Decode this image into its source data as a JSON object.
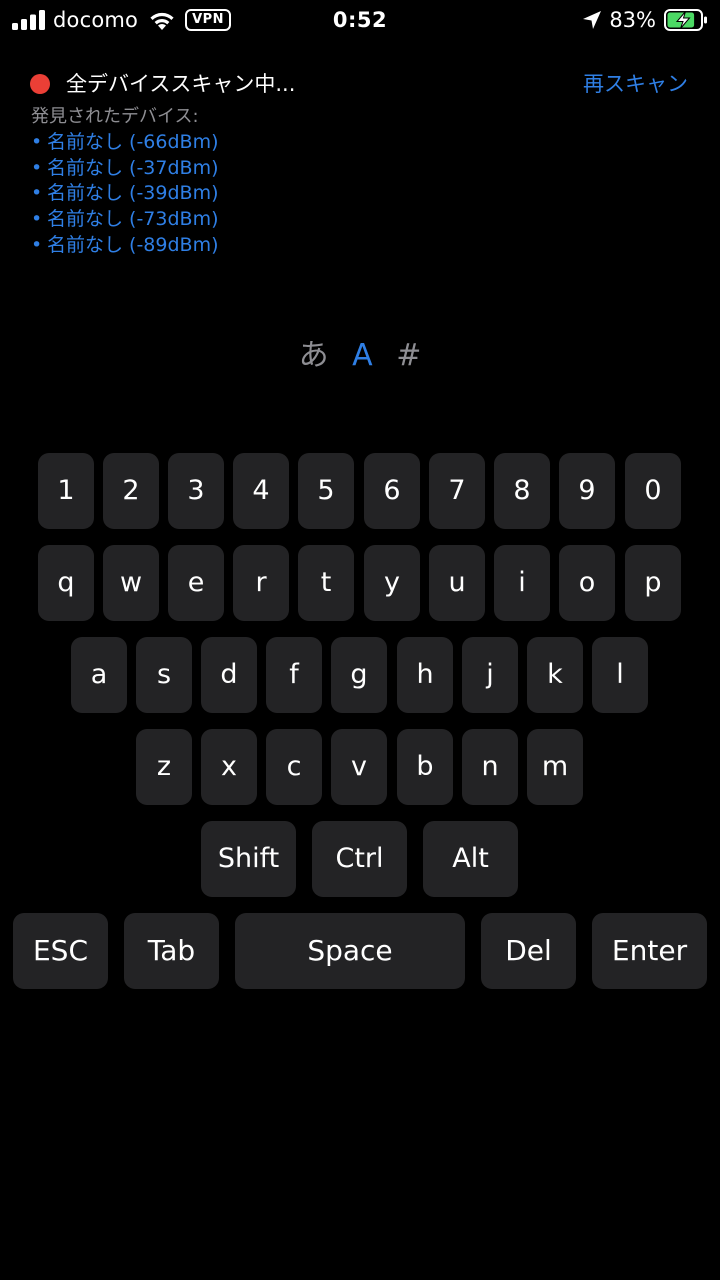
{
  "status_bar": {
    "carrier": "docomo",
    "vpn": "VPN",
    "time": "0:52",
    "battery_percent": "83%",
    "battery_level": 0.83,
    "icons": [
      "signal-icon",
      "wifi-icon",
      "location-icon",
      "battery-charging-icon"
    ]
  },
  "scan": {
    "status": "全デバイススキャン中...",
    "rescan_label": "再スキャン",
    "found_label": "発見されたデバイス:",
    "bullet": "•",
    "devices": [
      "名前なし (-66dBm)",
      "名前なし (-37dBm)",
      "名前なし (-39dBm)",
      "名前なし (-73dBm)",
      "名前なし (-89dBm)"
    ]
  },
  "modes": [
    "あ",
    "A",
    "#"
  ],
  "active_mode": "A",
  "keyboard": {
    "row_numbers": [
      "1",
      "2",
      "3",
      "4",
      "5",
      "6",
      "7",
      "8",
      "9",
      "0"
    ],
    "row_q": [
      "q",
      "w",
      "e",
      "r",
      "t",
      "y",
      "u",
      "i",
      "o",
      "p"
    ],
    "row_a": [
      "a",
      "s",
      "d",
      "f",
      "g",
      "h",
      "j",
      "k",
      "l"
    ],
    "row_z": [
      "z",
      "x",
      "c",
      "v",
      "b",
      "n",
      "m"
    ],
    "modifiers": [
      "Shift",
      "Ctrl",
      "Alt"
    ],
    "bottom": [
      "ESC",
      "Tab",
      "Space",
      "Del",
      "Enter"
    ]
  },
  "colors": {
    "background": "#000000",
    "key": "#232325",
    "accent": "#2f7fe5",
    "recording_dot": "#eb3f36",
    "muted": "#8e8e93",
    "battery_charging": "#4cd964"
  }
}
